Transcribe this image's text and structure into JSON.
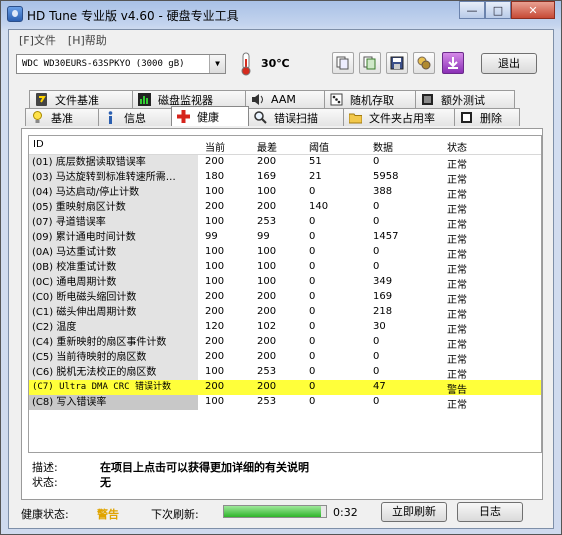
{
  "window": {
    "title": "HD Tune 专业版 v4.60 - 硬盘专业工具",
    "minimize": "—",
    "maximize": "□",
    "close": "✕"
  },
  "menu": [
    "[F]文件",
    "[H]帮助"
  ],
  "toolbar": {
    "drive": "WDC    WD30EURS-63SPKYO (3000 gB)",
    "temperature": "30℃",
    "exit_label": "退出",
    "buttons": [
      "copy-icon",
      "copy-all-icon",
      "save-icon",
      "options-icon",
      "download-icon"
    ]
  },
  "tabs_top": [
    "文件基准",
    "磁盘监视器",
    "AAM",
    "随机存取",
    "额外测试"
  ],
  "tabs_bottom": [
    "基准",
    "信息",
    "健康",
    "错误扫描",
    "文件夹占用率",
    "删除"
  ],
  "active_tab": "健康",
  "table": {
    "headers": [
      "ID",
      "当前",
      "最差",
      "阈值",
      "数据",
      "状态"
    ],
    "rows": [
      {
        "id": "(01) 底层数据读取错误率",
        "current": "200",
        "worst": "200",
        "threshold": "51",
        "data": "0",
        "status": "正常"
      },
      {
        "id": "(03) 马达旋转到标准转速所需…",
        "current": "180",
        "worst": "169",
        "threshold": "21",
        "data": "5958",
        "status": "正常"
      },
      {
        "id": "(04) 马达启动/停止计数",
        "current": "100",
        "worst": "100",
        "threshold": "0",
        "data": "388",
        "status": "正常"
      },
      {
        "id": "(05) 重映射扇区计数",
        "current": "200",
        "worst": "200",
        "threshold": "140",
        "data": "0",
        "status": "正常"
      },
      {
        "id": "(07) 寻道错误率",
        "current": "100",
        "worst": "253",
        "threshold": "0",
        "data": "0",
        "status": "正常"
      },
      {
        "id": "(09) 累计通电时间计数",
        "current": "99",
        "worst": "99",
        "threshold": "0",
        "data": "1457",
        "status": "正常"
      },
      {
        "id": "(0A) 马达重试计数",
        "current": "100",
        "worst": "100",
        "threshold": "0",
        "data": "0",
        "status": "正常"
      },
      {
        "id": "(0B) 校准重试计数",
        "current": "100",
        "worst": "100",
        "threshold": "0",
        "data": "0",
        "status": "正常"
      },
      {
        "id": "(0C) 通电周期计数",
        "current": "100",
        "worst": "100",
        "threshold": "0",
        "data": "349",
        "status": "正常"
      },
      {
        "id": "(C0) 断电磁头缩回计数",
        "current": "200",
        "worst": "200",
        "threshold": "0",
        "data": "169",
        "status": "正常"
      },
      {
        "id": "(C1) 磁头伸出周期计数",
        "current": "200",
        "worst": "200",
        "threshold": "0",
        "data": "218",
        "status": "正常"
      },
      {
        "id": "(C2) 温度",
        "current": "120",
        "worst": "102",
        "threshold": "0",
        "data": "30",
        "status": "正常"
      },
      {
        "id": "(C4) 重新映射的扇区事件计数",
        "current": "200",
        "worst": "200",
        "threshold": "0",
        "data": "0",
        "status": "正常"
      },
      {
        "id": "(C5) 当前待映射的扇区数",
        "current": "200",
        "worst": "200",
        "threshold": "0",
        "data": "0",
        "status": "正常"
      },
      {
        "id": "(C6) 脱机无法校正的扇区数",
        "current": "100",
        "worst": "253",
        "threshold": "0",
        "data": "0",
        "status": "正常"
      },
      {
        "id": "(C7) Ultra DMA CRC 错误计数",
        "current": "200",
        "worst": "200",
        "threshold": "0",
        "data": "47",
        "status": "警告"
      },
      {
        "id": "(C8) 写入错误率",
        "current": "100",
        "worst": "253",
        "threshold": "0",
        "data": "0",
        "status": "正常"
      }
    ]
  },
  "description": {
    "desc_label": "描述:",
    "desc_text": "在项目上点击可以获得更加详细的有关说明",
    "state_label": "状态:",
    "state_text": "无"
  },
  "statusbar": {
    "health_label": "健康状态:",
    "health_value": "警告",
    "next_refresh_label": "下次刷新:",
    "refresh_progress": 0.95,
    "countdown": "0:32",
    "refresh_button": "立即刷新",
    "log_button": "日志"
  },
  "colors": {
    "highlight_row": "#ffff3a",
    "warning_text": "#e0a400",
    "progress": "#2fb52a"
  }
}
